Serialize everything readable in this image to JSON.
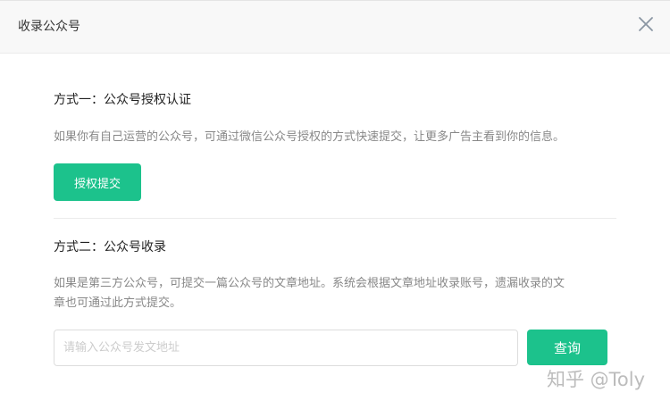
{
  "dialog": {
    "title": "收录公众号",
    "close_icon": "close-icon"
  },
  "method_one": {
    "title": "方式一：公众号授权认证",
    "description": "如果你有自己运营的公众号，可通过微信公众号授权的方式快速提交，让更多广告主看到你的信息。",
    "button_label": "授权提交"
  },
  "method_two": {
    "title": "方式二：公众号收录",
    "description_line1": "如果是第三方公众号，可提交一篇公众号的文章地址。系统会根据文章地址收录账号，遗漏收录的文",
    "description_line2": "章也可通过此方式提交。",
    "input_value": "",
    "input_placeholder": "请输入公众号发文地址",
    "query_label": "查询"
  },
  "watermark": "知乎 @Toly",
  "colors": {
    "accent": "#1cc28c",
    "header_bg": "#f8f8f8",
    "muted_text": "#888888"
  }
}
